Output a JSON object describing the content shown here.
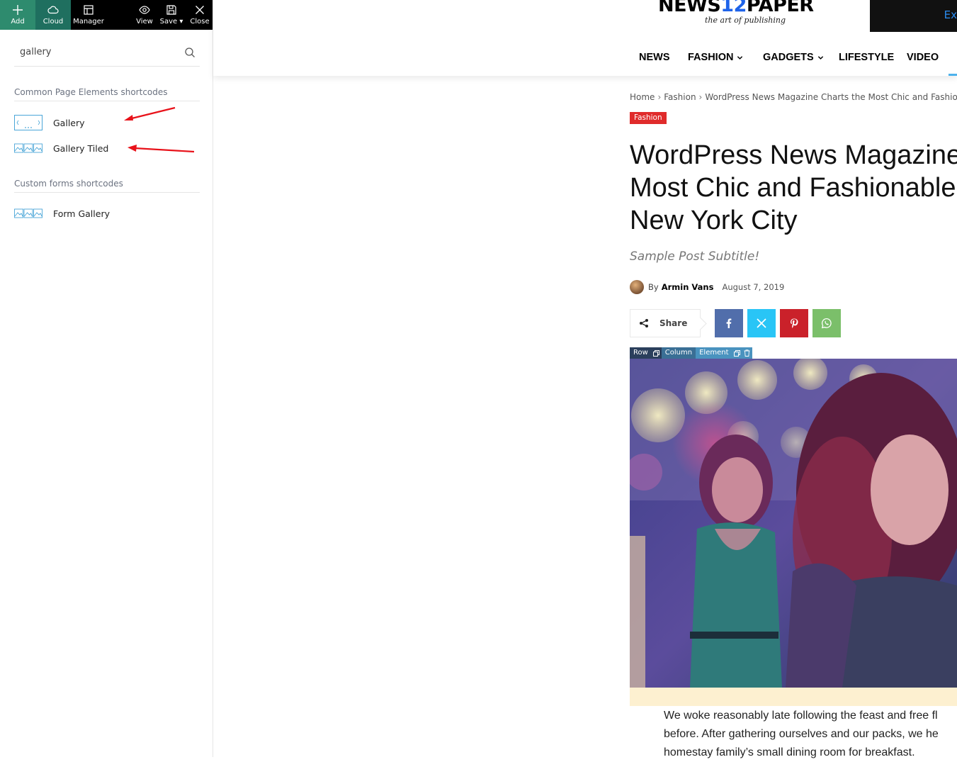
{
  "toolbar": {
    "add_label": "Add",
    "cloud_label": "Cloud",
    "manager_label": "Manager",
    "view_label": "View",
    "save_label": "Save",
    "close_label": "Close"
  },
  "search": {
    "value": "gallery"
  },
  "sections": [
    {
      "title": "Common Page Elements shortcodes",
      "items": [
        {
          "label": "Gallery",
          "icon": "gallery-slider-icon"
        },
        {
          "label": "Gallery Tiled",
          "icon": "gallery-tiled-icon"
        }
      ]
    },
    {
      "title": "Custom forms shortcodes",
      "items": [
        {
          "label": "Form Gallery",
          "icon": "gallery-tiled-icon"
        }
      ]
    }
  ],
  "site": {
    "logo_part1": "NEWS",
    "logo_part2": "12",
    "logo_part3": "PAPER",
    "tagline": "the art of publishing",
    "ad_text": "Ex",
    "nav": [
      "NEWS",
      "FASHION",
      "GADGETS",
      "LIFESTYLE",
      "VIDEO"
    ]
  },
  "post": {
    "breadcrumb": [
      "Home",
      "Fashion",
      "WordPress News Magazine Charts the Most Chic and Fashionable"
    ],
    "category": "Fashion",
    "title_lines": [
      "WordPress News Magazine",
      "Most Chic and Fashionable",
      "New York City"
    ],
    "subtitle": "Sample Post Subtitle!",
    "by": "By",
    "author": "Armin Vans",
    "date": "August 7, 2019",
    "share_label": "Share",
    "body_lines": [
      "We woke reasonably late following the feast and free fl",
      "before. After gathering ourselves and our packs, we he",
      "homestay family’s small dining room for breakfast."
    ]
  },
  "editor_tags": {
    "row": "Row",
    "column": "Column",
    "element": "Element"
  },
  "colors": {
    "accent_green": "#2e8b6e",
    "badge_red": "#e02b2b",
    "facebook": "#516eab",
    "twitter": "#29c5f6",
    "pinterest": "#ca212a",
    "whatsapp": "#7bbf6a"
  }
}
